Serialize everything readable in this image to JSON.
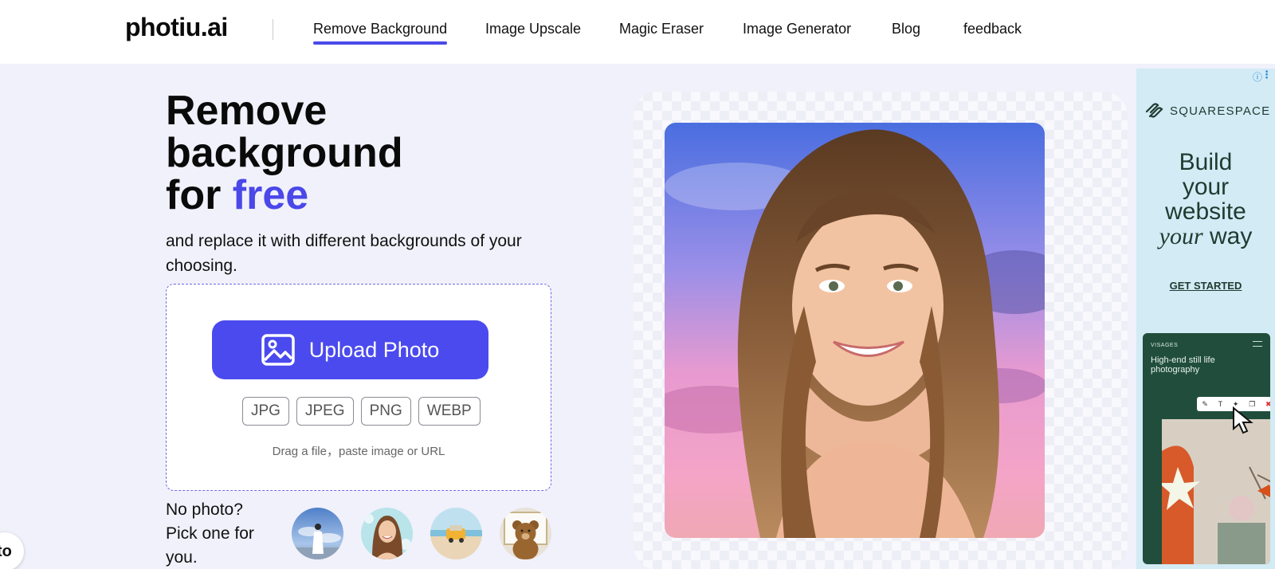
{
  "header": {
    "logo": "photiu.ai",
    "nav": [
      {
        "label": "Remove Background",
        "active": true
      },
      {
        "label": "Image Upscale",
        "active": false
      },
      {
        "label": "Magic Eraser",
        "active": false
      },
      {
        "label": "Image Generator",
        "active": false
      },
      {
        "label": "Blog",
        "active": false
      },
      {
        "label": "feedback",
        "active": false
      }
    ]
  },
  "hero": {
    "title_line1": "Remove",
    "title_line2": "background",
    "title_line3_prefix": "for ",
    "title_line3_accent": "free",
    "subtitle": "and replace it with different backgrounds of your choosing."
  },
  "upload": {
    "button_label": "Upload Photo",
    "formats": [
      "JPG",
      "JPEG",
      "PNG",
      "WEBP"
    ],
    "hint": "Drag a file，paste image or URL"
  },
  "samples": {
    "prompt": "No photo? Pick one for you.",
    "items": [
      "sample-sky-woman",
      "sample-portrait",
      "sample-beach-car",
      "sample-teddy-bear"
    ]
  },
  "ad": {
    "brand": "SQUARESPACE",
    "headline_1": "Build",
    "headline_2": "your",
    "headline_3": "website",
    "headline_4_italic": "your",
    "headline_4_rest": " way",
    "cta": "GET STARTED",
    "mock_brand": "VISAGES",
    "mock_text": "High-end still life photography"
  },
  "chat": {
    "label": "to"
  },
  "colors": {
    "accent": "#4b4aee",
    "page_bg": "#f1f1fb",
    "ad_bg": "#d2ebf5",
    "ad_dark": "#214e3c"
  }
}
